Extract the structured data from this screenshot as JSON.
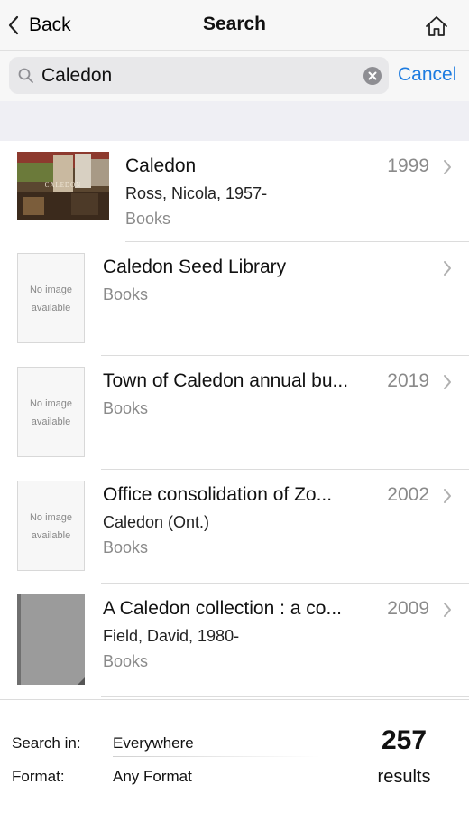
{
  "nav": {
    "back_label": "Back",
    "title": "Search"
  },
  "search": {
    "value": "Caledon",
    "cancel_label": "Cancel"
  },
  "results": [
    {
      "title": "Caledon",
      "year": "1999",
      "author": "Ross, Nicola, 1957-",
      "format": "Books",
      "cover": "photo",
      "cover_text": "CALEDON"
    },
    {
      "title": "Caledon Seed Library",
      "year": "",
      "author": "",
      "format": "Books",
      "cover": "none"
    },
    {
      "title": "Town of Caledon annual bu...",
      "year": "2019",
      "author": "",
      "format": "Books",
      "cover": "none"
    },
    {
      "title": "Office consolidation of Zo...",
      "year": "2002",
      "author": "Caledon (Ont.)",
      "format": "Books",
      "cover": "none"
    },
    {
      "title": "A Caledon collection : a co...",
      "year": "2009",
      "author": "Field, David, 1980-",
      "format": "Books",
      "cover": "grey"
    }
  ],
  "no_image": {
    "line1": "No image",
    "line2": "available"
  },
  "footer": {
    "search_in_label": "Search in:",
    "search_in_value": "Everywhere",
    "format_label": "Format:",
    "format_value": "Any Format",
    "count": "257",
    "count_label": "results"
  },
  "colors": {
    "accent": "#1e7ce0",
    "secondary_text": "#8a8a8a",
    "bar_bg": "#f7f7f7",
    "field_bg": "#e8e8ea"
  },
  "icons": {
    "back": "chevron-left-icon",
    "home": "home-icon",
    "search": "magnifier-icon",
    "clear": "clear-x-icon",
    "disclosure": "chevron-right-icon"
  }
}
